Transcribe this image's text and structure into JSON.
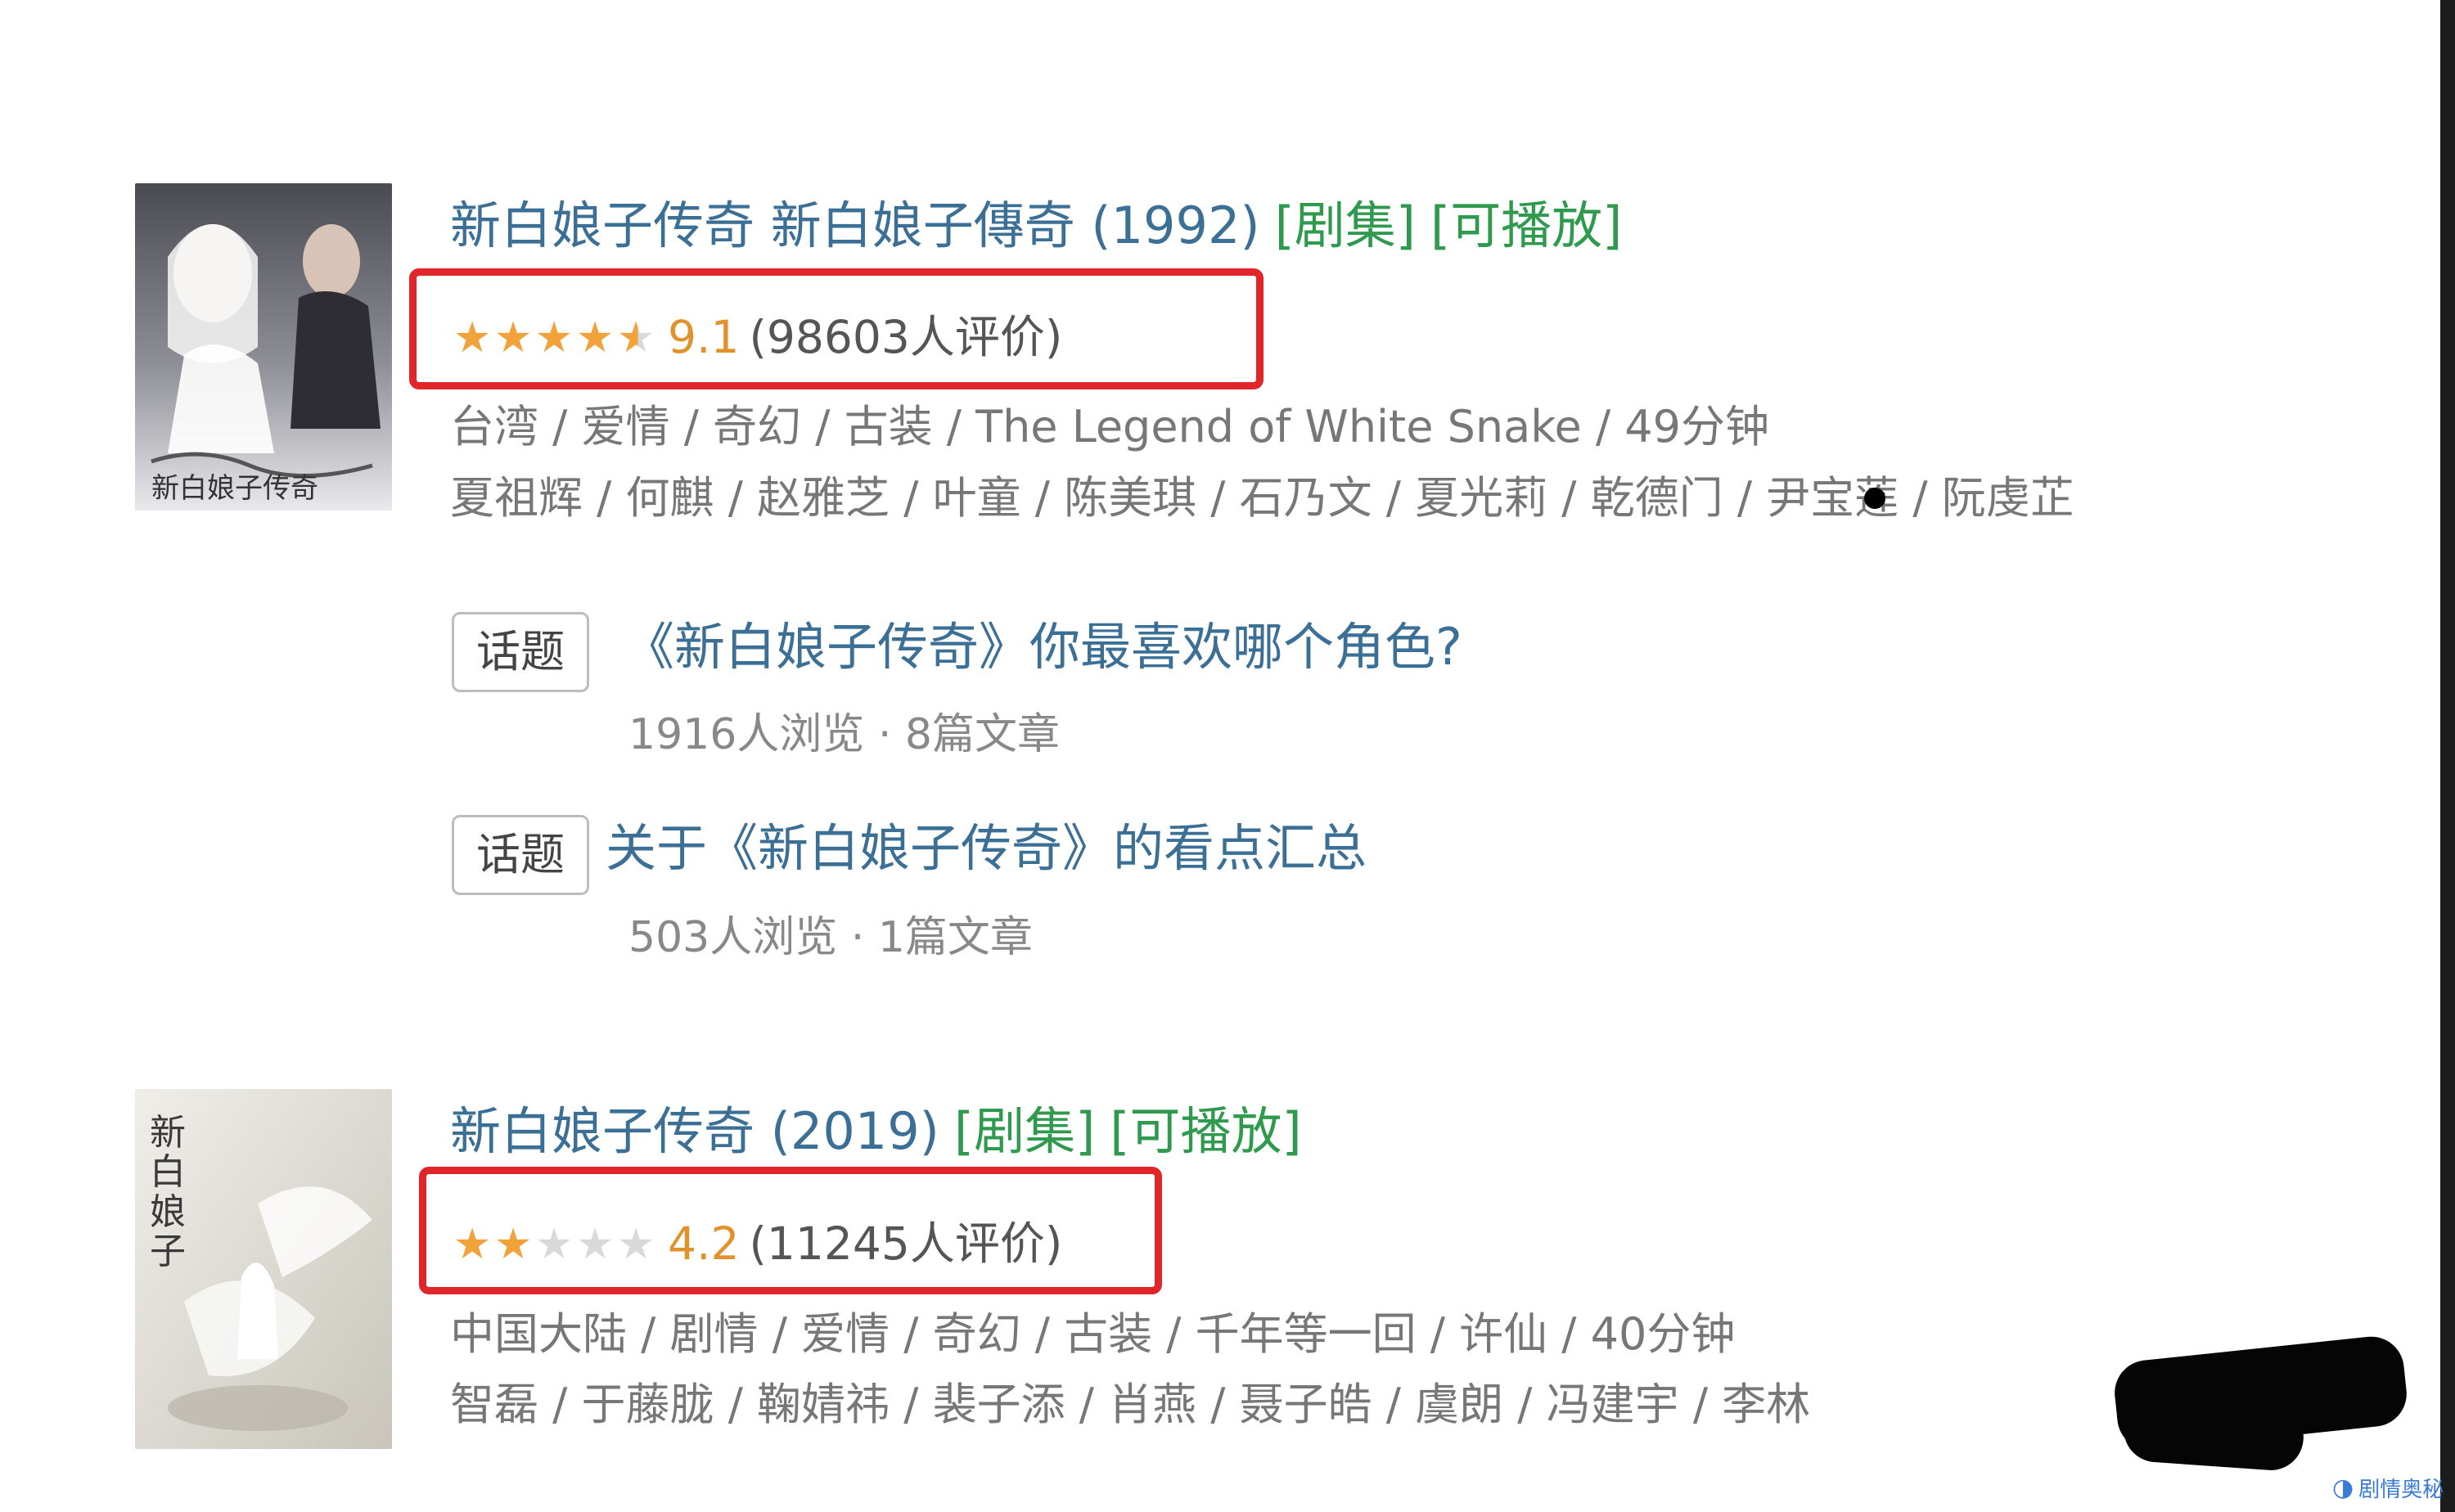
{
  "results": [
    {
      "title": "新白娘子传奇 新白娘子傳奇 (1992)",
      "tag_series": "[剧集]",
      "tag_playable": "[可播放]",
      "stars": "4.5 of 5",
      "score": "9.1",
      "votes": "(98603人评价)",
      "meta_line": "台湾 / 爱情 / 奇幻 / 古装 / The Legend of White Snake / 49分钟",
      "cast_line": "夏祖辉 / 何麒 / 赵雅芝 / 叶童 / 陈美琪 / 石乃文 / 夏光莉 / 乾德门 / 尹宝莲 / 阮虔芷",
      "poster_caption": "新白娘子传奇",
      "topics": [
        {
          "badge": "话题",
          "title": "《新白娘子传奇》你最喜欢哪个角色?",
          "stats": "1916人浏览 · 8篇文章"
        },
        {
          "badge": "话题",
          "title": "关于《新白娘子传奇》的看点汇总",
          "stats": "503人浏览 · 1篇文章"
        }
      ]
    },
    {
      "title": "新白娘子传奇 (2019)",
      "tag_series": "[剧集]",
      "tag_playable": "[可播放]",
      "stars": "2 of 5",
      "score": "4.2",
      "votes": "(11245人评价)",
      "meta_line": "中国大陆 / 剧情 / 爱情 / 奇幻 / 古装 / 千年等一回 / 许仙 / 40分钟",
      "cast_line": "智磊 / 于藤胧 / 鞠婧祎 / 裴子添 / 肖燕 / 聂子皓 / 虞朗 / 冯建宇 / 李林",
      "poster_caption": "新白娘子"
    }
  ],
  "watermark": "剧情奥秘",
  "colors": {
    "title": "#3b6f96",
    "tag": "#2f9a4e",
    "star": "#f2a23a",
    "highlight": "#e0252b"
  }
}
